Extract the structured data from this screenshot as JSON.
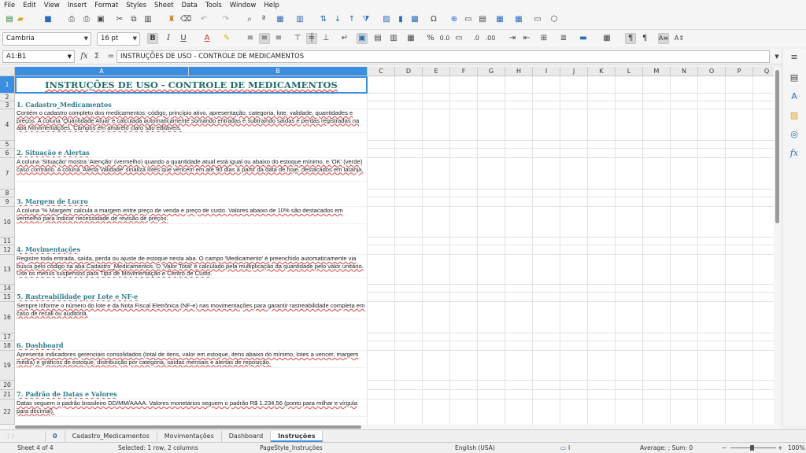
{
  "menu": [
    "File",
    "Edit",
    "View",
    "Insert",
    "Format",
    "Styles",
    "Sheet",
    "Data",
    "Tools",
    "Window",
    "Help"
  ],
  "format": {
    "font_name": "Cambria",
    "font_size": "16 pt"
  },
  "formula_bar": {
    "name_box": "A1:B1",
    "content": "INSTRUÇÕES DE USO - CONTROLE DE MEDICAMENTOS"
  },
  "columns": [
    "A",
    "B",
    "C",
    "D",
    "E",
    "F",
    "G",
    "H",
    "I",
    "J",
    "K",
    "L",
    "M",
    "N",
    "O",
    "P",
    "Q"
  ],
  "rows": [
    "1",
    "2",
    "3",
    "4",
    "5",
    "6",
    "7",
    "8",
    "9",
    "10",
    "11",
    "12",
    "13",
    "14",
    "15",
    "16",
    "17",
    "18",
    "19",
    "20",
    "21",
    "22"
  ],
  "cells": {
    "title": "INSTRUÇÕES DE USO - CONTROLE DE MEDICAMENTOS",
    "s1_h": "1. Cadastro_Medicamentos",
    "s1_b": "Contém o cadastro completo dos medicamentos: código, princípio ativo, apresentação, categoria, lote, validade, quantidades e preços. A coluna 'Quantidade Atual' é calculada automaticamente somando entradas e subtraindo saídas e perdas registradas na aba Movimentações. Campos em amarelo claro são editáveis.",
    "s2_h": "2. Situação e Alertas",
    "s2_b": "A coluna 'Situação' mostra 'Atenção' (vermelho) quando a quantidade atual está igual ou abaixo do estoque mínimo, e 'OK' (verde) caso contrário. A coluna 'Alerta Validade' sinaliza lotes que vencem em até 90 dias a partir da data de hoje, destacados em laranja.",
    "s3_h": "3. Margem de Lucro",
    "s3_b": "A coluna '% Margem' calcula a margem entre preço de venda e preço de custo. Valores abaixo de 10% são destacados em vermelho para indicar necessidade de revisão de preços.",
    "s4_h": "4. Movimentações",
    "s4_b": "Registre toda entrada, saída, perda ou ajuste de estoque nesta aba. O campo 'Medicamento' é preenchido automaticamente via busca pelo código na aba Cadastro_Medicamentos. O 'Valor Total' é calculado pela multiplicação da quantidade pelo valor unitário. Use os menus suspensos para Tipo de Movimentação e Centro de Custo.",
    "s5_h": "5. Rastreabilidade por Lote e NF-e",
    "s5_b": "Sempre informe o número do lote e da Nota Fiscal Eletrônica (NF-e) nas movimentações para garantir rastreabilidade completa em caso de recall ou auditoria.",
    "s6_h": "6. Dashboard",
    "s6_b": "Apresenta indicadores gerenciais consolidados (total de itens, valor em estoque, itens abaixo do mínimo, lotes a vencer, margem média) e gráficos de estoque, distribuição por categoria, saídas mensais e alertas de reposição.",
    "s7_h": "7. Padrão de Datas e Valores",
    "s7_b": "Datas seguem o padrão brasileiro DD/MM/AAAA. Valores monetários seguem o padrão R$ 1.234,56 (ponto para milhar e vírgula para decimal)."
  },
  "tabs": [
    "0",
    "Cadastro_Medicamentos",
    "Movimentações",
    "Dashboard",
    "Instruções"
  ],
  "status": {
    "sheet": "Sheet 4 of 4",
    "selection": "Selected: 1 row, 2 columns",
    "page_style": "PageStyle_Instruções",
    "language": "English (USA)",
    "summary": "Average: ; Sum: 0",
    "zoom": "100%"
  }
}
